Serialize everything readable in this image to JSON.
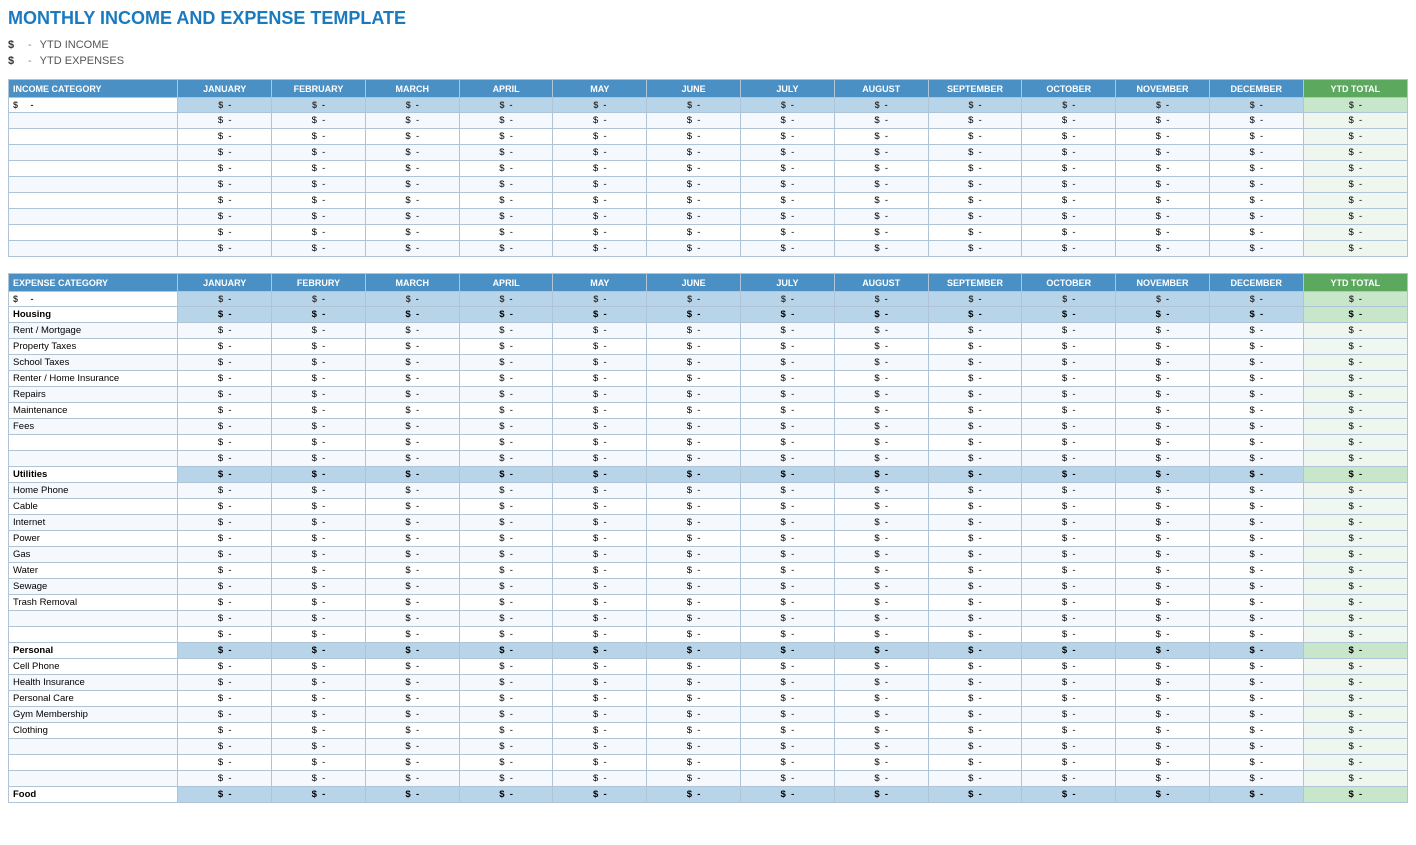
{
  "title": "MONTHLY INCOME AND EXPENSE TEMPLATE",
  "ytd_income_label": "YTD INCOME",
  "ytd_expenses_label": "YTD EXPENSES",
  "dollar_sign": "$",
  "dash": "-",
  "months": [
    "JANUARY",
    "FEBRUARY",
    "MARCH",
    "APRIL",
    "MAY",
    "JUNE",
    "JULY",
    "AUGUST",
    "SEPTEMBER",
    "OCTOBER",
    "NOVEMBER",
    "DECEMBER"
  ],
  "ytd_total_label": "YTD TOTAL",
  "income_category_label": "INCOME CATEGORY",
  "expense_category_label": "EXPENSE CATEGORY",
  "income_rows": [
    {
      "label": "",
      "values": [
        "-",
        "-",
        "-",
        "-",
        "-",
        "-",
        "-",
        "-",
        "-",
        "-",
        "-",
        "-"
      ],
      "ytd": "-"
    },
    {
      "label": "",
      "values": [
        "-",
        "-",
        "-",
        "-",
        "-",
        "-",
        "-",
        "-",
        "-",
        "-",
        "-",
        "-"
      ],
      "ytd": "-"
    },
    {
      "label": "",
      "values": [
        "-",
        "-",
        "-",
        "-",
        "-",
        "-",
        "-",
        "-",
        "-",
        "-",
        "-",
        "-"
      ],
      "ytd": "-"
    },
    {
      "label": "",
      "values": [
        "-",
        "-",
        "-",
        "-",
        "-",
        "-",
        "-",
        "-",
        "-",
        "-",
        "-",
        "-"
      ],
      "ytd": "-"
    },
    {
      "label": "",
      "values": [
        "-",
        "-",
        "-",
        "-",
        "-",
        "-",
        "-",
        "-",
        "-",
        "-",
        "-",
        "-"
      ],
      "ytd": "-"
    },
    {
      "label": "",
      "values": [
        "-",
        "-",
        "-",
        "-",
        "-",
        "-",
        "-",
        "-",
        "-",
        "-",
        "-",
        "-"
      ],
      "ytd": "-"
    },
    {
      "label": "",
      "values": [
        "-",
        "-",
        "-",
        "-",
        "-",
        "-",
        "-",
        "-",
        "-",
        "-",
        "-",
        "-"
      ],
      "ytd": "-"
    },
    {
      "label": "",
      "values": [
        "-",
        "-",
        "-",
        "-",
        "-",
        "-",
        "-",
        "-",
        "-",
        "-",
        "-",
        "-"
      ],
      "ytd": "-"
    },
    {
      "label": "",
      "values": [
        "-",
        "-",
        "-",
        "-",
        "-",
        "-",
        "-",
        "-",
        "-",
        "-",
        "-",
        "-"
      ],
      "ytd": "-"
    }
  ],
  "expense_sections": [
    {
      "name": "Housing",
      "items": [
        "Rent / Mortgage",
        "Property Taxes",
        "School Taxes",
        "Renter / Home Insurance",
        "Repairs",
        "Maintenance",
        "Fees",
        "",
        ""
      ]
    },
    {
      "name": "Utilities",
      "items": [
        "Home Phone",
        "Cable",
        "Internet",
        "Power",
        "Gas",
        "Water",
        "Sewage",
        "Trash Removal",
        "",
        ""
      ]
    },
    {
      "name": "Personal",
      "items": [
        "Cell Phone",
        "Health Insurance",
        "Personal Care",
        "Gym Membership",
        "Clothing",
        "",
        "",
        ""
      ]
    },
    {
      "name": "Food",
      "items": []
    }
  ]
}
